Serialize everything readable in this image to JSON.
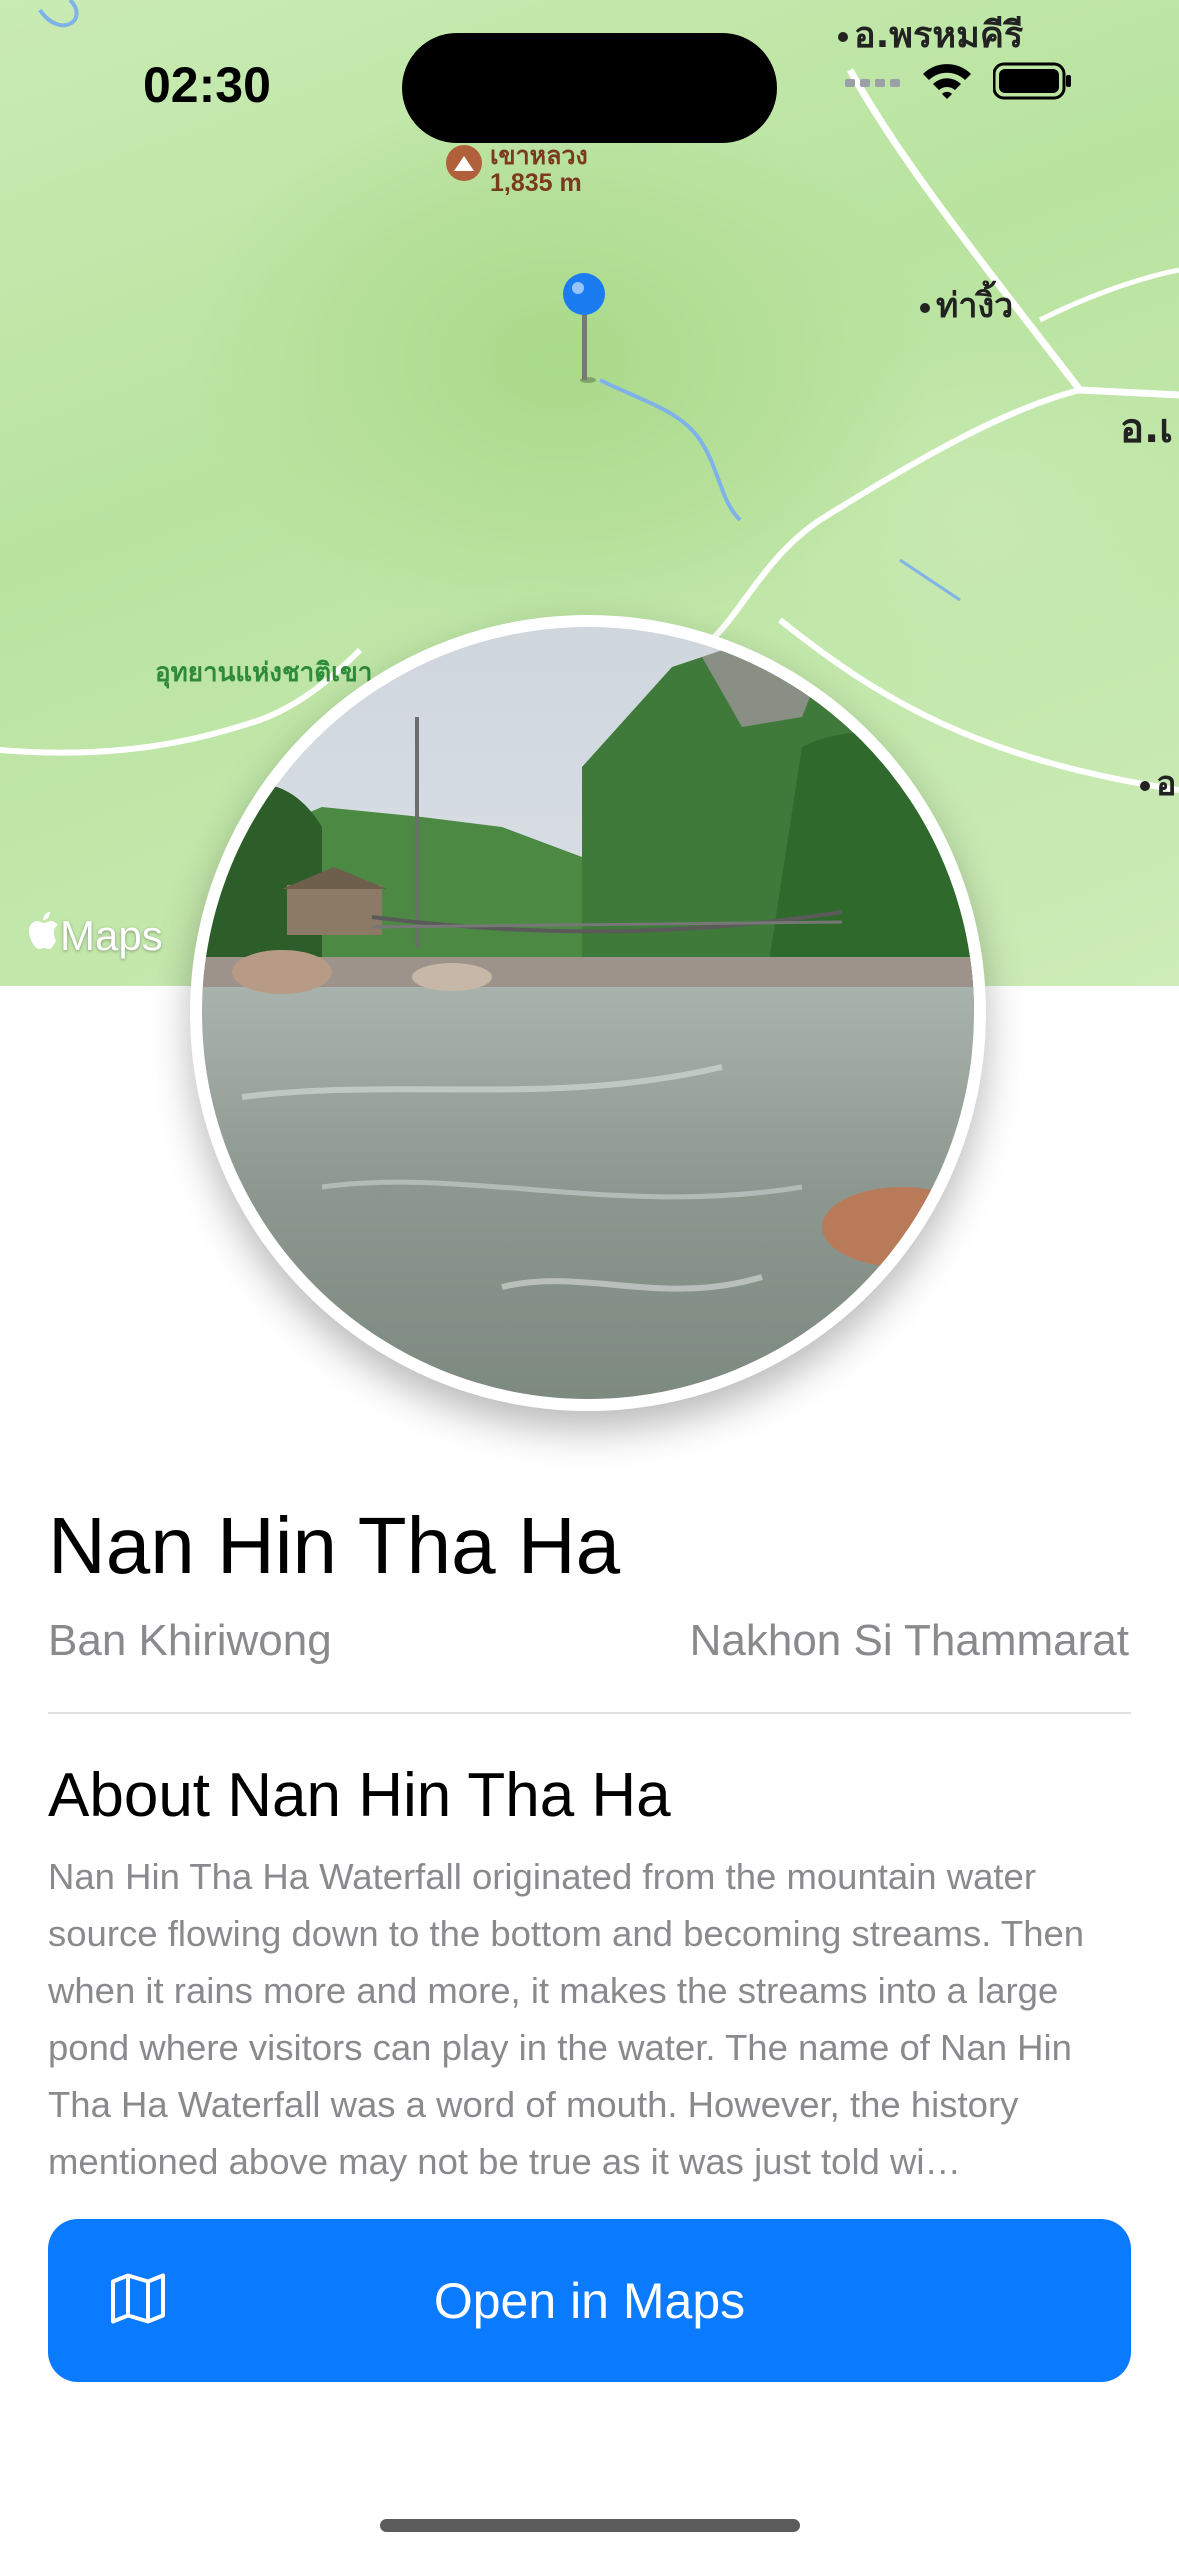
{
  "status_bar": {
    "time": "02:30",
    "signal_icon": "cellular-signal-icon",
    "wifi_icon": "wifi-icon",
    "battery_icon": "battery-icon"
  },
  "map": {
    "labels": [
      "อ.พรหมคีรี",
      "ท่างิ้ว",
      "อ.เ",
      "อุทยานแห่งชาติเขา",
      "อ"
    ],
    "poi": {
      "name": "เขาหลวง",
      "elevation": "1,835 m",
      "icon": "mountain-icon"
    },
    "pin_icon": "location-pin-icon",
    "attribution": "Maps",
    "attribution_icon": "apple-logo-icon",
    "colors": {
      "land": "#b9e39f",
      "forest": "#a9d98a",
      "pin": "#1a7cf0",
      "road": "#ffffff"
    }
  },
  "place": {
    "photo_alt": "River rapids with a suspension bridge and forested mountain",
    "title": "Nan Hin Tha Ha",
    "locality": "Ban Khiriwong",
    "province": "Nakhon Si Thammarat"
  },
  "about": {
    "heading": "About Nan Hin Tha Ha",
    "body": "Nan Hin Tha Ha Waterfall originated from the mountain water source flowing down to the bottom and becoming streams. Then when it rains more and more, it makes the streams into a large pond where visitors can play in the water. The name of Nan Hin Tha Ha Waterfall was a word of mouth. However, the history mentioned above may not be true as it was just told wi…"
  },
  "action": {
    "open_in_maps_label": "Open in Maps",
    "icon": "map-icon",
    "color": "#0a7aff"
  }
}
